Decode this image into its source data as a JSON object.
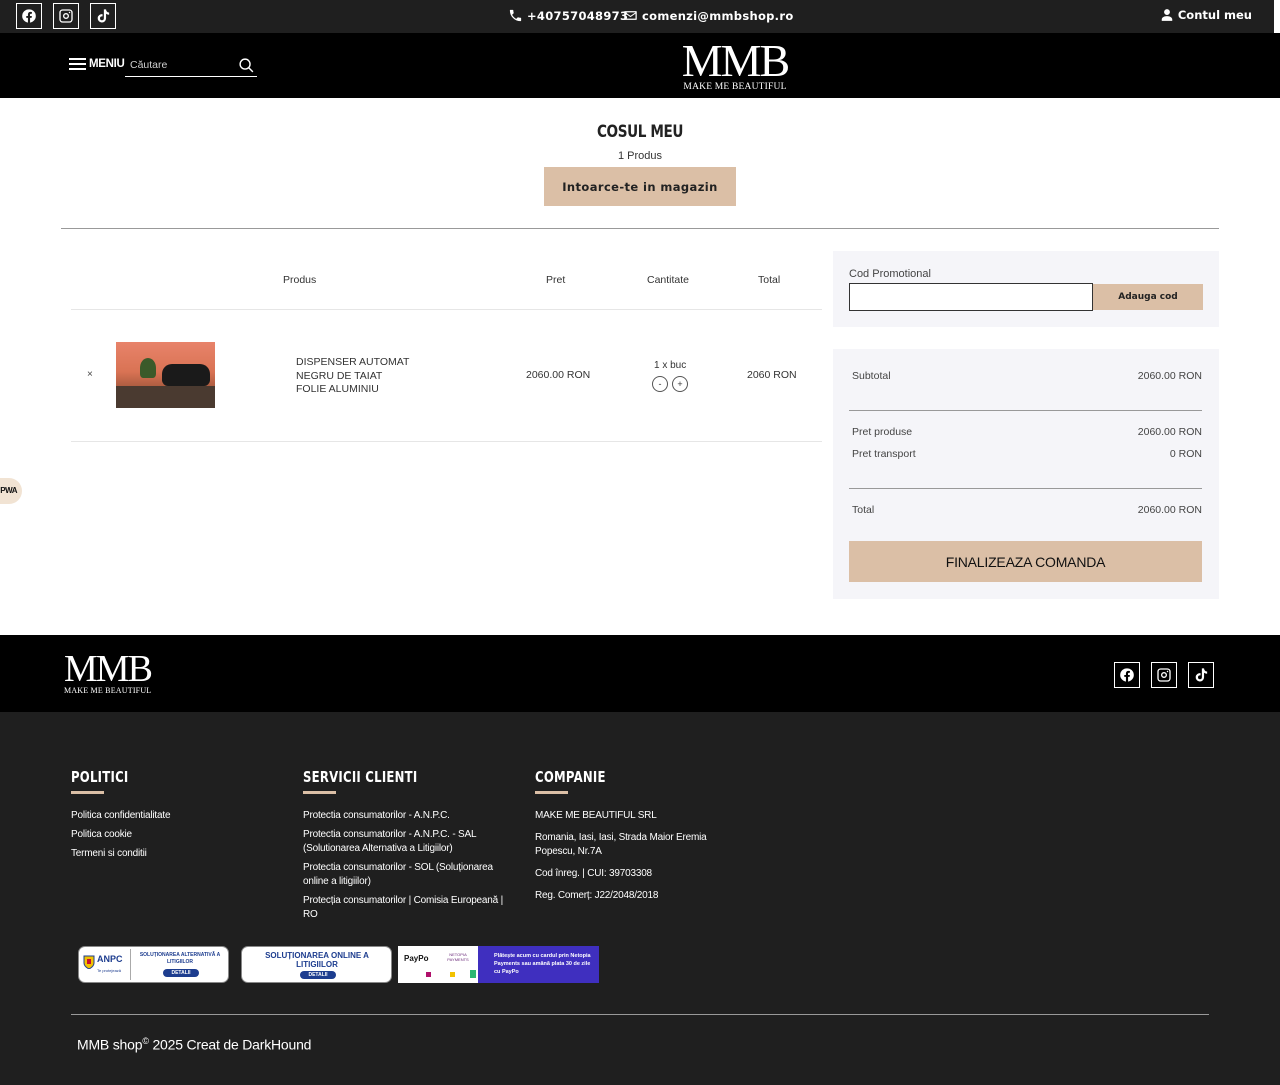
{
  "topbar": {
    "phone": "+40757048973",
    "email": "comenzi@mmbshop.ro",
    "account": "Contul meu",
    "social": [
      "facebook-icon",
      "instagram-icon",
      "tiktok-icon"
    ]
  },
  "header": {
    "menu_label": "MENIU",
    "search_placeholder": "Căutare",
    "logo_big": "MMB",
    "logo_small": "MAKE ME BEAUTIFUL"
  },
  "cart": {
    "title": "COSUL MEU",
    "count": "1 Produs",
    "back_button": "Intoarce-te in magazin",
    "columns": [
      "Produs",
      "Pret",
      "Cantitate",
      "Total"
    ],
    "items": [
      {
        "remove": "×",
        "name": "DISPENSER AUTOMAT NEGRU DE TAIAT FOLIE ALUMINIU",
        "name_lines": [
          "DISPENSER AUTOMAT",
          "NEGRU DE TAIAT",
          "FOLIE ALUMINIU"
        ],
        "price": "2060.00 RON",
        "quantity": "1 x buc",
        "minus": "-",
        "plus": "+",
        "total": "2060 RON"
      }
    ]
  },
  "promo": {
    "label": "Cod Promotional",
    "input_value": "",
    "button": "Adauga cod"
  },
  "summary": {
    "subtotal_label": "Subtotal",
    "subtotal_value": "2060.00 RON",
    "products_label": "Pret produse",
    "products_value": "2060.00 RON",
    "shipping_label": "Pret transport",
    "shipping_value": "0 RON",
    "total_label": "Total",
    "total_value": "2060.00 RON",
    "checkout_button": "FINALIZEAZA COMANDA"
  },
  "pwa_label": "PWA",
  "footer": {
    "logo_big": "MMB",
    "logo_small": "MAKE ME BEAUTIFUL",
    "columns": {
      "politici": {
        "title": "POLITICI",
        "links": [
          "Politica confidentialitate",
          "Politica cookie",
          "Termeni si conditii"
        ]
      },
      "servicii": {
        "title": "SERVICII CLIENTI",
        "links": [
          "Protectia consumatorilor - A.N.P.C.",
          "Protectia consumatorilor - A.N.P.C. - SAL (Solutionarea Alternativa a Litigiilor)",
          "Protectia consumatorilor - SOL (Soluționarea online a litigiilor)",
          "Protecția consumatorilor | Comisia Europeană | RO"
        ]
      },
      "companie": {
        "title": "COMPANIE",
        "lines": [
          "MAKE ME BEAUTIFUL SRL",
          "Romania, Iasi, Iasi, Strada Maior Eremia Popescu, Nr.7A",
          "Cod înreg. | CUI: 39703308",
          "Reg. Comerț: J22/2048/2018"
        ]
      }
    },
    "badges": {
      "anpc_title": "ANPC",
      "anpc_sub": "Te protejează",
      "sal_text": "SOLUȚIONAREA ALTERNATIVĂ A LITIGIILOR",
      "sal_detail": "DETALII",
      "sol_text": "SOLUȚIONAREA ONLINE A LITIGIILOR",
      "sol_detail": "DETALII",
      "paypo_brand": "PayPo",
      "netopia_brand": "NETOPIA PAYMENTS",
      "paypo_text": "Plătește acum cu cardul prin Netopia Payments sau amână plata 30 de zile cu PayPo"
    },
    "copyright_brand": "MMB shop",
    "copyright_symbol": "©",
    "copyright_rest": " 2025 Creat de DarkHound"
  },
  "colors": {
    "accent": "#dbbfa6",
    "dark": "#1f1f1f",
    "black": "#000000",
    "panel": "#f5f5f9"
  }
}
